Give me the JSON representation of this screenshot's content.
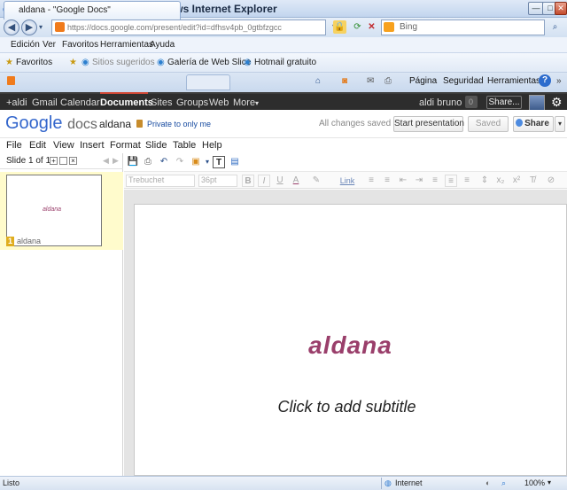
{
  "window": {
    "title": "aldana - \"Google Docs\" - Windows Internet Explorer"
  },
  "browser": {
    "address": "https://docs.google.com/present/edit?id=dfhsv4pb_0gtbfzgcc",
    "search_placeholder": "Bing",
    "menu": [
      "Edición",
      "Ver",
      "Favoritos",
      "Herramientas",
      "Ayuda"
    ],
    "favorites_label": "Favoritos",
    "fav_links": [
      "Sitios sugeridos",
      "Galería de Web Slice",
      "Hotmail gratuito"
    ],
    "tab_title": "aldana - \"Google Docs\"",
    "commands": [
      "Página",
      "Seguridad",
      "Herramientas"
    ]
  },
  "gbar": {
    "links": [
      "+aldi",
      "Gmail",
      "Calendar",
      "Documents",
      "Sites",
      "Groups",
      "Web",
      "More"
    ],
    "active": "Documents",
    "user": "aldi bruno",
    "count": "0",
    "share": "Share..."
  },
  "header": {
    "logo_google": "Google",
    "logo_docs": "docs",
    "doc_title": "aldana",
    "privacy": "Private to only me",
    "save_status": "All changes saved",
    "start_btn": "Start presentation",
    "saved_btn": "Saved",
    "share_btn": "Share"
  },
  "app_menu": [
    "File",
    "Edit",
    "View",
    "Insert",
    "Format",
    "Slide",
    "Table",
    "Help"
  ],
  "slides_panel": {
    "label": "Slide 1 of 1",
    "thumb_title": "aldana",
    "thumb_num": "1",
    "thumb_label": "aldana"
  },
  "format_bar": {
    "font": "Trebuchet",
    "size": "36pt",
    "bold": "B",
    "italic": "I",
    "underline": "U",
    "text_color": "A",
    "link": "Link"
  },
  "slide": {
    "title": "aldana",
    "subtitle": "Click to add subtitle"
  },
  "colors": {
    "accent_title": "#9a3f6b",
    "gbar_bg": "#2d2d2d",
    "ie_chrome": "#d3e1f2"
  },
  "status": {
    "left": "Listo",
    "zone": "Internet",
    "zoom": "100%"
  }
}
